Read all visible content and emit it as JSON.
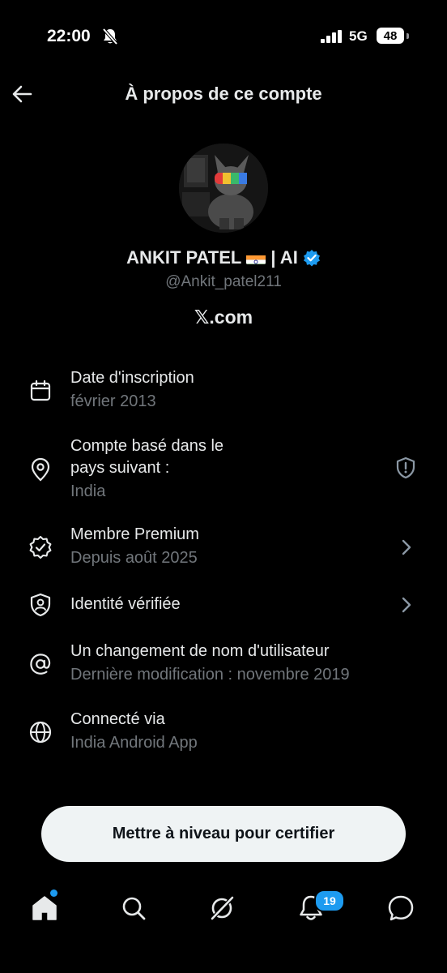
{
  "status_bar": {
    "time": "22:00",
    "network": "5G",
    "battery": "48"
  },
  "header": {
    "title": "À propos de ce compte"
  },
  "profile": {
    "name": "ANKIT PATEL",
    "name_suffix": "| AI",
    "handle": "@Ankit_patel211",
    "site": "𝕏.com"
  },
  "rows": [
    {
      "title": "Date d'inscription",
      "sub": "février 2013",
      "icon": "calendar-icon"
    },
    {
      "title": "Compte basé dans le pays suivant :",
      "sub": "India",
      "icon": "location-pin-icon",
      "trailing_icon": "shield-alert-icon"
    },
    {
      "title": "Membre Premium",
      "sub": "Depuis août 2025",
      "icon": "verified-check-icon",
      "trailing_icon": "chevron-right-icon"
    },
    {
      "title": "Identité vérifiée",
      "sub": "",
      "icon": "identity-shield-icon",
      "trailing_icon": "chevron-right-icon"
    },
    {
      "title": "Un changement de nom d'utilisateur",
      "sub": "Dernière modification : novembre 2019",
      "icon": "at-sign-icon"
    },
    {
      "title": "Connecté via",
      "sub": "India Android App",
      "icon": "globe-icon"
    }
  ],
  "cta": {
    "label": "Mettre à niveau pour certifier"
  },
  "bottom_nav": {
    "items": [
      "home-icon",
      "search-icon",
      "grok-icon",
      "notifications-icon",
      "messages-icon"
    ],
    "notification_count": "19"
  },
  "colors": {
    "background": "#000000",
    "text_primary": "#e7e9ea",
    "text_secondary": "#71767b",
    "accent": "#1d9bf0"
  }
}
